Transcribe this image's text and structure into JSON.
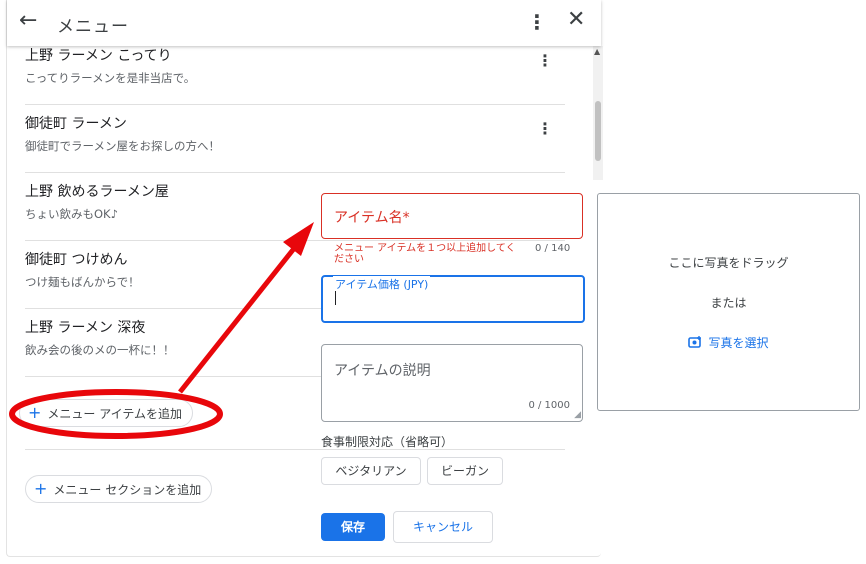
{
  "header": {
    "back_icon": "←",
    "title": "メニュー",
    "more_icon": "⋮",
    "close_icon": "✕"
  },
  "menu_items": [
    {
      "name": "上野 ラーメン こってり",
      "description": "こってりラーメンを是非当店で。"
    },
    {
      "name": "御徒町 ラーメン",
      "description": "御徒町でラーメン屋をお探しの方へ！"
    },
    {
      "name": "上野 飲めるラーメン屋",
      "description": "ちょい飲みもOK♪"
    },
    {
      "name": "御徒町 つけめん",
      "description": "つけ麺もばんからで！"
    },
    {
      "name": "上野 ラーメン 深夜",
      "description": "飲み会の後のメの一杯に！！"
    }
  ],
  "add_item_label": "メニュー アイテムを追加",
  "add_section_label": "メニュー セクションを追加",
  "form": {
    "item_name_label": "アイテム名*",
    "item_name_error": "メニュー アイテムを１つ以上追加してください",
    "item_name_counter": "0 / 140",
    "price_label": "アイテム価格 (JPY)",
    "description_label": "アイテムの説明",
    "description_counter": "0 / 1000",
    "dietary_label": "食事制限対応（省略可）",
    "dietary_options": [
      "ベジタリアン",
      "ビーガン"
    ],
    "save_label": "保存",
    "cancel_label": "キャンセル"
  },
  "photo": {
    "drag_text": "ここに写真をドラッグ",
    "or_text": "または",
    "select_label": "写真を選択"
  },
  "colors": {
    "accent": "#1a73e8",
    "error": "#d93025",
    "annotation": "#e8070b"
  }
}
